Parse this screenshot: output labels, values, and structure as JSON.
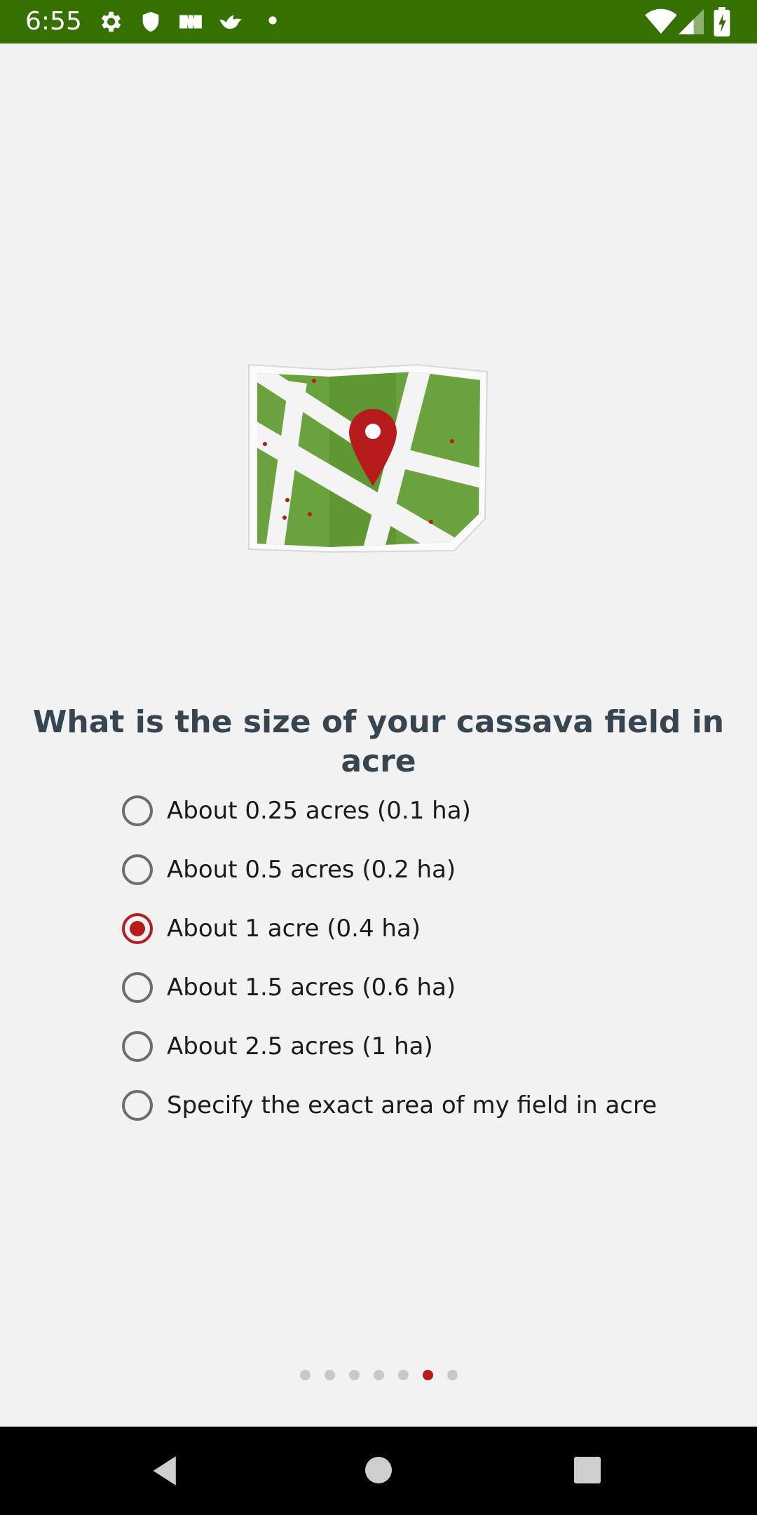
{
  "status_bar": {
    "time": "6:55",
    "left_icons": [
      "gear-icon",
      "shield-icon",
      "app-notification-icon",
      "bird-icon",
      "dot-icon"
    ],
    "right_icons": [
      "wifi-icon",
      "cell-signal-icon",
      "battery-charging-icon"
    ]
  },
  "illustration": {
    "icon": "map-pin-icon",
    "accent": "#b71c1c",
    "field_color": "#6aa23d"
  },
  "question": {
    "text": "What is the size of your cassava field in acre"
  },
  "options": [
    {
      "label": "About 0.25 acres (0.1 ha)",
      "selected": false
    },
    {
      "label": "About 0.5 acres (0.2 ha)",
      "selected": false
    },
    {
      "label": "About 1 acre (0.4 ha)",
      "selected": true
    },
    {
      "label": "About 1.5 acres (0.6 ha)",
      "selected": false
    },
    {
      "label": "About 2.5 acres (1 ha)",
      "selected": false
    },
    {
      "label": "Specify the exact area of my field in acre",
      "selected": false
    }
  ],
  "pager": {
    "total": 7,
    "current": 6
  },
  "nav_bar": {
    "buttons": [
      "back-icon",
      "home-icon",
      "recents-icon"
    ]
  },
  "colors": {
    "status_bar": "#367000",
    "accent": "#b71c1c",
    "background": "#f2f2f2",
    "question_text": "#36454f"
  }
}
